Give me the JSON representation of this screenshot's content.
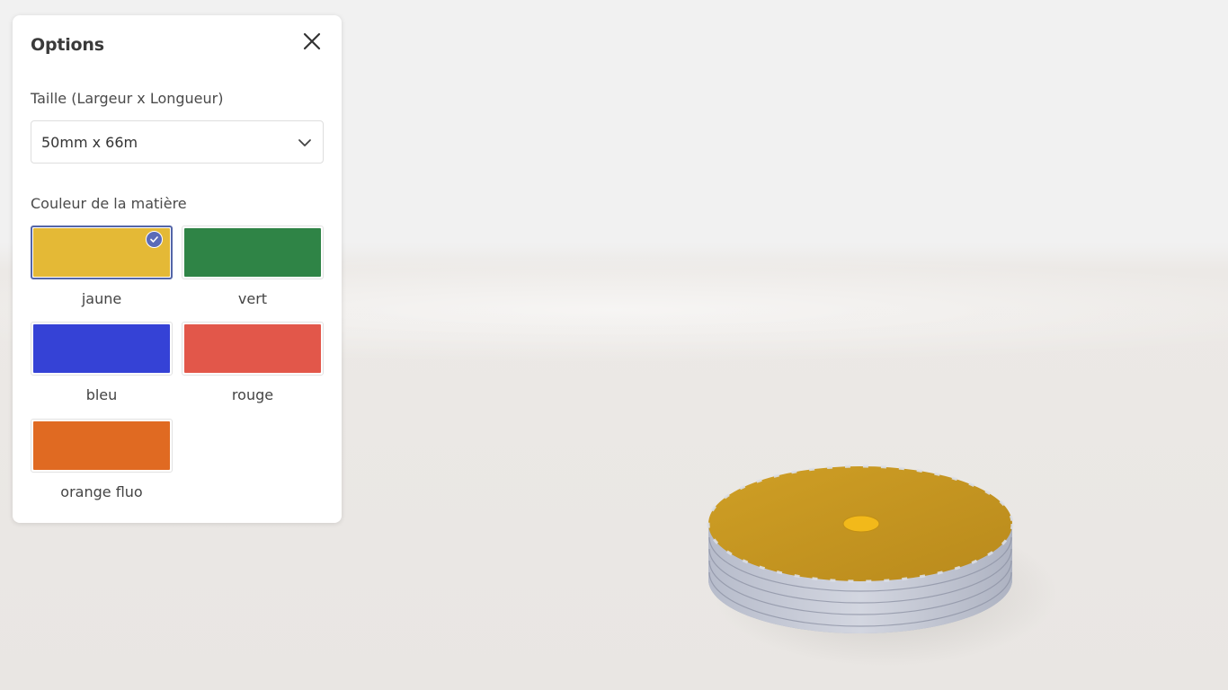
{
  "panel": {
    "title": "Options",
    "close_icon": "close-icon"
  },
  "size": {
    "label": "Taille (Largeur x Longueur)",
    "selected": "50mm x 66m",
    "chevron_icon": "chevron-down-icon"
  },
  "color": {
    "label": "Couleur de la matière",
    "selected": "jaune",
    "options": [
      {
        "name": "jaune",
        "hex": "#e4b936"
      },
      {
        "name": "vert",
        "hex": "#2f8446"
      },
      {
        "name": "bleu",
        "hex": "#3542d6"
      },
      {
        "name": "rouge",
        "hex": "#e2574a"
      },
      {
        "name": "orange fluo",
        "hex": "#e06a22"
      }
    ],
    "check_icon": "check-icon"
  },
  "viewer": {
    "model_top_color": "#c9981f",
    "model_side_color": "#c5c9d6"
  }
}
